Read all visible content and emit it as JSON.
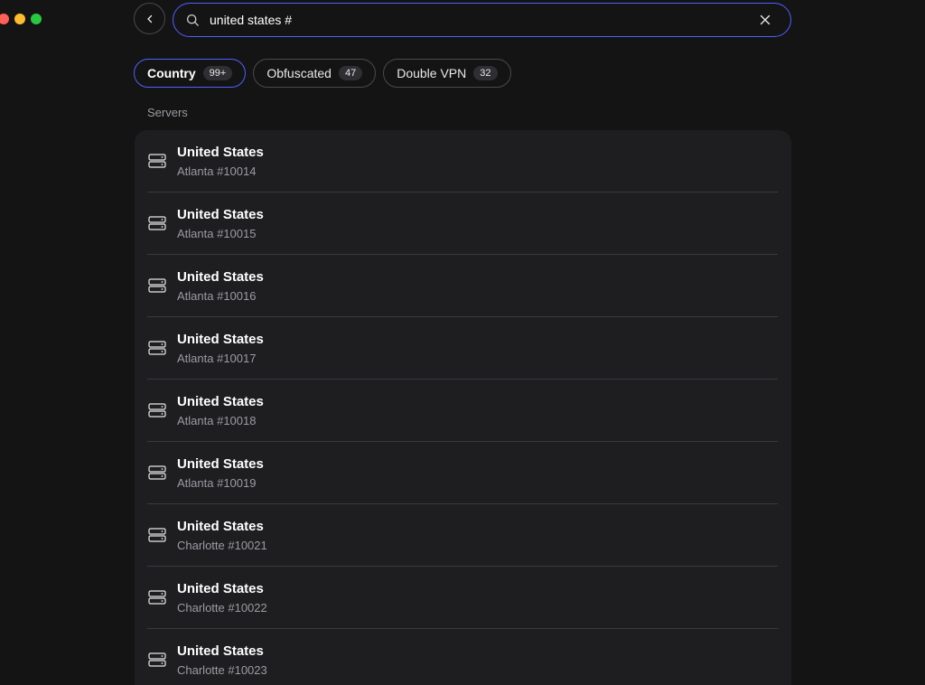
{
  "window": {
    "controls": [
      "close",
      "minimize",
      "zoom"
    ]
  },
  "header": {
    "back_icon": "chevron-left-icon",
    "search": {
      "icon": "search-icon",
      "value": "united states #",
      "clear_icon": "close-icon"
    }
  },
  "filters": [
    {
      "label": "Country",
      "count": "99+",
      "active": true
    },
    {
      "label": "Obfuscated",
      "count": "47",
      "active": false
    },
    {
      "label": "Double VPN",
      "count": "32",
      "active": false
    }
  ],
  "section": {
    "label": "Servers"
  },
  "servers": [
    {
      "country": "United States",
      "name": "Atlanta #10014",
      "icon": "server-icon"
    },
    {
      "country": "United States",
      "name": "Atlanta #10015",
      "icon": "server-icon"
    },
    {
      "country": "United States",
      "name": "Atlanta #10016",
      "icon": "server-icon"
    },
    {
      "country": "United States",
      "name": "Atlanta #10017",
      "icon": "server-icon"
    },
    {
      "country": "United States",
      "name": "Atlanta #10018",
      "icon": "server-icon"
    },
    {
      "country": "United States",
      "name": "Atlanta #10019",
      "icon": "server-icon"
    },
    {
      "country": "United States",
      "name": "Charlotte #10021",
      "icon": "server-icon"
    },
    {
      "country": "United States",
      "name": "Charlotte #10022",
      "icon": "server-icon"
    },
    {
      "country": "United States",
      "name": "Charlotte #10023",
      "icon": "server-icon"
    }
  ],
  "colors": {
    "background": "#141415",
    "panel": "#1e1e21",
    "accent": "#4f60ff",
    "muted_text": "#9b9ba1"
  }
}
